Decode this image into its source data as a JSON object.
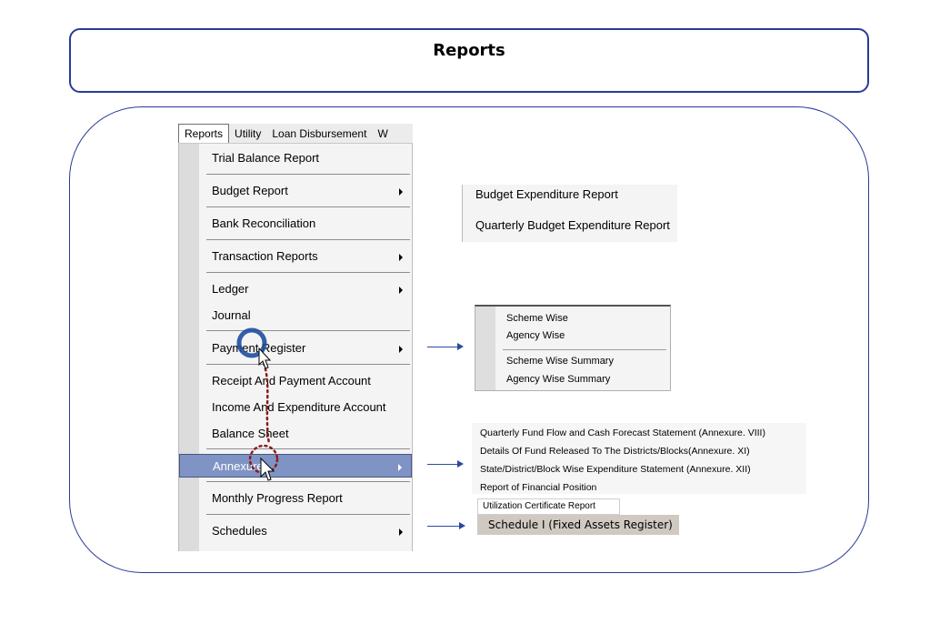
{
  "title": "Reports",
  "menubar": {
    "items": [
      "Reports",
      "Utility",
      "Loan Disbursement",
      "W"
    ]
  },
  "dropdown": {
    "items": [
      {
        "label": "Trial Balance Report",
        "submenu": false
      },
      {
        "label": "Budget Report",
        "submenu": true
      },
      {
        "label": "Bank Reconciliation",
        "submenu": false
      },
      {
        "label": "Transaction Reports",
        "submenu": true
      },
      {
        "label": "Ledger",
        "submenu": true
      },
      {
        "label": "Journal",
        "submenu": false
      },
      {
        "label": "Payment Register",
        "submenu": true
      },
      {
        "label": "Receipt And Payment Account",
        "submenu": false
      },
      {
        "label": "Income And Expenditure Account",
        "submenu": false
      },
      {
        "label": "Balance Sheet",
        "submenu": false
      },
      {
        "label": "Annexure",
        "submenu": true,
        "highlighted": true
      },
      {
        "label": "Monthly Progress Report",
        "submenu": false
      },
      {
        "label": "Schedules",
        "submenu": true
      }
    ]
  },
  "budget_submenu": {
    "items": [
      "Budget Expenditure Report",
      "Quarterly Budget Expenditure Report"
    ]
  },
  "payment_submenu": {
    "items": [
      "Scheme Wise",
      "Agency Wise",
      "Scheme Wise Summary",
      "Agency Wise Summary"
    ]
  },
  "annexure_submenu": {
    "items": [
      "Quarterly Fund Flow and Cash Forecast Statement (Annexure. VIII)",
      "Details Of Fund Released To The Districts/Blocks(Annexure. XI)",
      "State/District/Block Wise Expenditure Statement (Annexure. XII)",
      "Report of Financial Position"
    ],
    "utilization": "Utilization Certificate Report"
  },
  "schedules_submenu": {
    "item": "Schedule I (Fixed Assets Register)"
  },
  "colors": {
    "frame_border": "#2a3a9a",
    "highlight": "#7f93c4",
    "connector": "#2a4aa0",
    "annotation_ring": "#1f4fa0",
    "annotation_dots": "#8b1a1a"
  }
}
